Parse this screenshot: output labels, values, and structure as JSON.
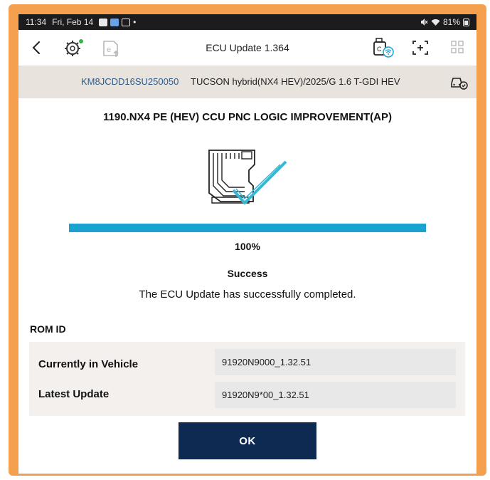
{
  "status_bar": {
    "time": "11:34",
    "date": "Fri, Feb 14",
    "notification_dot": "•",
    "battery": "81%",
    "icons": [
      "image-icon",
      "app-icon",
      "download-icon",
      "mute-icon",
      "wifi-icon",
      "battery-icon"
    ]
  },
  "app_bar": {
    "title": "ECU Update 1.364",
    "icons": [
      "back-icon",
      "ecu-gear-icon",
      "e-upload-icon",
      "vci-icon",
      "scan-icon",
      "grid-icon"
    ]
  },
  "vehicle": {
    "vin": "KM8JCDD16SU250050",
    "description": "TUCSON hybrid(NX4 HEV)/2025/G 1.6 T-GDI HEV"
  },
  "update": {
    "title": "1190.NX4 PE (HEV) CCU PNC LOGIC IMPROVEMENT(AP)",
    "progress_percent": 100,
    "progress_text": "100%",
    "status_title": "Success",
    "status_message": "The ECU Update has successfully completed."
  },
  "rom": {
    "heading": "ROM ID",
    "rows": [
      {
        "label": "Currently in Vehicle",
        "value": "91920N9000_1.32.51"
      },
      {
        "label": "Latest Update",
        "value": "91920N9*00_1.32.51"
      }
    ]
  },
  "ok_label": "OK",
  "colors": {
    "frame": "#f5a04f",
    "progress": "#1aa3cf",
    "button": "#0e2a52",
    "vin": "#2f5c8a",
    "vehicle_bar": "#e8e3dd",
    "check": "#3ab6d3"
  }
}
